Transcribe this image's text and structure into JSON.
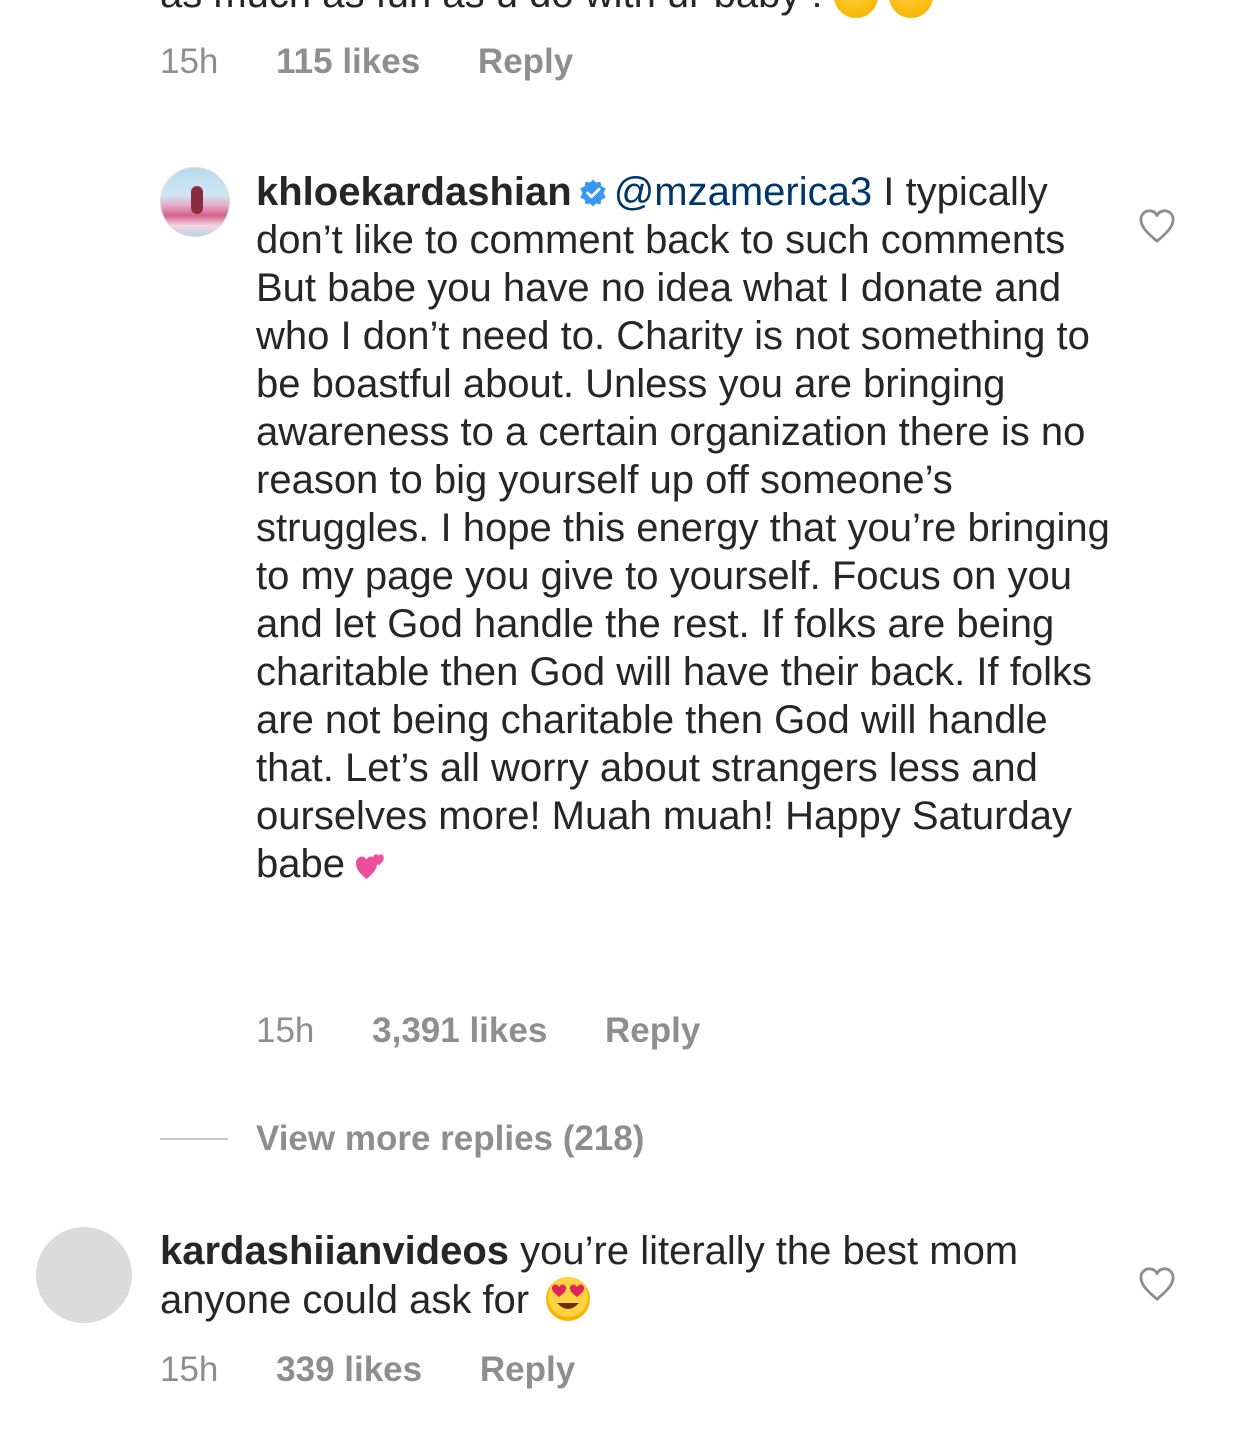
{
  "top_comment": {
    "text_visible": "as much as fun as u do with ur baby !",
    "emojis": [
      "smiling-face-icon",
      "kissing-face-icon"
    ],
    "time": "15h",
    "likes": "115 likes",
    "reply_label": "Reply"
  },
  "khloe_comment": {
    "username": "khloekardashian",
    "verified": true,
    "mention": "@mzamerica3",
    "text": " I typically don’t like to comment back to such comments But babe you have no idea what I donate and who I don’t need to. Charity is not something to be boastful about. Unless you are bringing awareness to a certain organization there is no reason to big yourself up off someone’s struggles. I hope this energy that you’re bringing to my page you give to yourself. Focus on you and let God handle the rest. If folks are being charitable then God will have their back. If folks are not being charitable then God will handle that. Let’s all worry about strangers less and ourselves more! Muah muah! Happy Saturday babe",
    "time": "15h",
    "likes": "3,391 likes",
    "reply_label": "Reply"
  },
  "view_more_replies": "View more replies (218)",
  "kard_comment": {
    "username": "kardashiianvideos",
    "text": " you’re literally the best mom anyone could ask for",
    "time": "15h",
    "likes": "339 likes",
    "reply_label": "Reply"
  },
  "colors": {
    "text": "#262626",
    "meta": "#8e8e8e",
    "mention": "#00376b",
    "verified": "#3897f0",
    "divider": "#c7c7c7",
    "avatar_placeholder": "#dbdbdb"
  }
}
